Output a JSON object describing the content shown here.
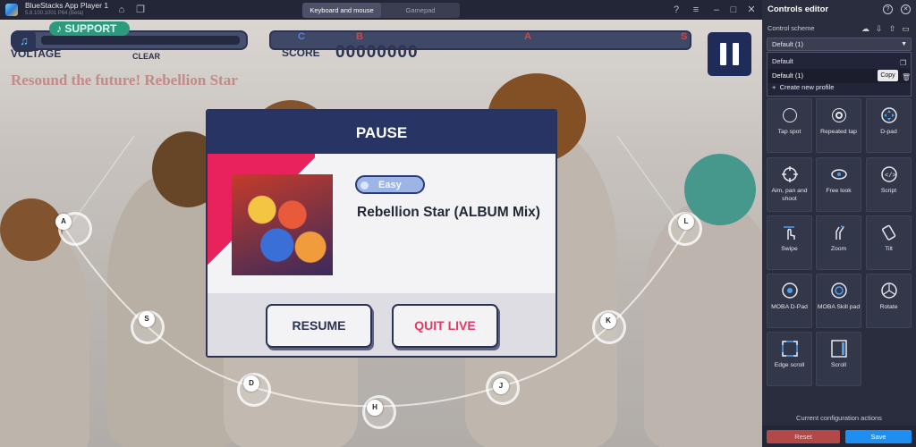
{
  "titlebar": {
    "app_title": "BlueStacks App Player 1",
    "app_subtitle": "5.8.100.1001 P64 (Beta)",
    "tabs": [
      "Keyboard and mouse",
      "Gamepad"
    ],
    "icons": [
      "home-icon",
      "multi-instance-icon",
      "help-icon",
      "menu-icon",
      "minimize-icon",
      "maximize-icon",
      "close-icon"
    ]
  },
  "game": {
    "support_label": "SUPPORT",
    "voltage_label": "VOLTAGE",
    "clear_label": "CLEAR",
    "score_label": "SCORE",
    "score_value": "00000000",
    "ranks": [
      "C",
      "B",
      "A",
      "S"
    ],
    "rank_colors": [
      "#5f7fd6",
      "#d8443f",
      "#d8443f",
      "#d8443f"
    ],
    "song_title": "Resound the future! Rebellion Star",
    "lane_keys": [
      "A",
      "S",
      "D",
      "H",
      "J",
      "K",
      "L"
    ]
  },
  "pause_modal": {
    "title": "PAUSE",
    "difficulty": "Easy",
    "song_name": "Rebellion Star (ALBUM Mix)",
    "resume_label": "RESUME",
    "quit_label": "QUIT LIVE",
    "accent_color": "#e8235c",
    "header_color": "#283463"
  },
  "controls_editor": {
    "title": "Controls editor",
    "scheme_label": "Control scheme",
    "selected_scheme": "Default (1)",
    "options": [
      "Default",
      "Default (1)"
    ],
    "copy_tooltip": "Copy",
    "create_new": "Create new profile",
    "tiles": [
      {
        "label": "Tap spot",
        "icon": "tap-spot-icon"
      },
      {
        "label": "Repeated tap",
        "icon": "repeated-tap-icon"
      },
      {
        "label": "D-pad",
        "icon": "dpad-icon"
      },
      {
        "label": "Aim, pan and shoot",
        "icon": "crosshair-icon"
      },
      {
        "label": "Free look",
        "icon": "free-look-icon"
      },
      {
        "label": "Script",
        "icon": "script-icon"
      },
      {
        "label": "Swipe",
        "icon": "swipe-icon"
      },
      {
        "label": "Zoom",
        "icon": "zoom-icon"
      },
      {
        "label": "Tilt",
        "icon": "tilt-icon"
      },
      {
        "label": "MOBA D-Pad",
        "icon": "moba-dpad-icon"
      },
      {
        "label": "MOBA Skill pad",
        "icon": "moba-skill-icon"
      },
      {
        "label": "Rotate",
        "icon": "rotate-icon"
      },
      {
        "label": "Edge scroll",
        "icon": "edge-scroll-icon"
      },
      {
        "label": "Scroll",
        "icon": "scroll-icon"
      }
    ],
    "config_actions_label": "Current configuration actions",
    "reset_label": "Reset",
    "save_label": "Save"
  }
}
